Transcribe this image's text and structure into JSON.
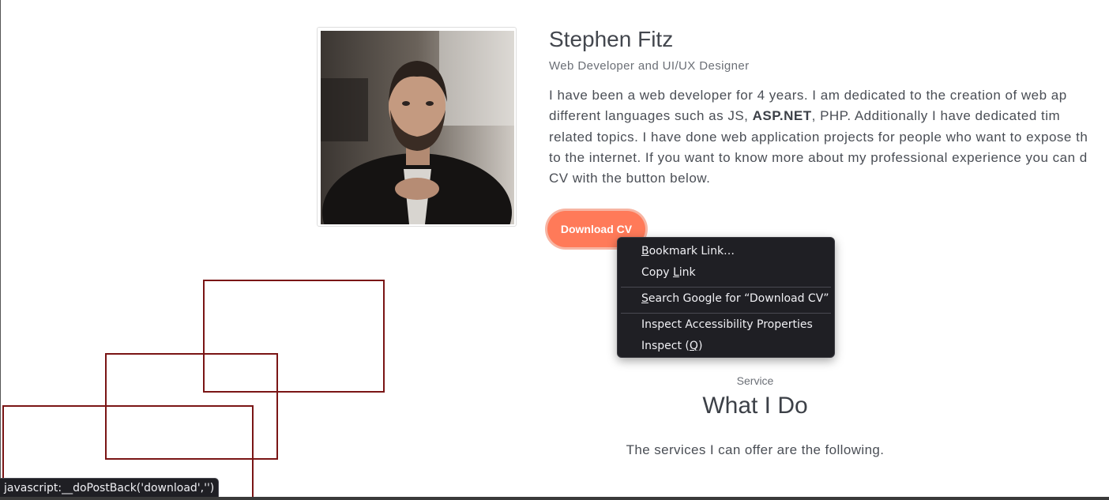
{
  "profile": {
    "name": "Stephen Fitz",
    "subtitle": "Web Developer and UI/UX Designer",
    "bio_lines": [
      [
        "I have been a web developer for 4 years. I am dedicated to the creation of web ap",
        "",
        ""
      ],
      [
        "different languages such as JS, ",
        "ASP.NET",
        ", PHP. Additionally I have dedicated tim"
      ],
      [
        "related topics. I have done web application projects for people who want to expose th",
        "",
        ""
      ],
      [
        "to the internet. If you want to know more about my professional experience you can d",
        "",
        ""
      ],
      [
        "CV with the button below.",
        "",
        ""
      ]
    ],
    "download_label": "Download CV"
  },
  "services": {
    "eyebrow": "Service",
    "title": "What I Do",
    "subtitle": "The services I can offer are the following."
  },
  "context_menu": {
    "items": [
      {
        "prefix": "",
        "accel": "B",
        "rest": "ookmark Link…"
      },
      {
        "prefix": "Copy ",
        "accel": "L",
        "rest": "ink"
      },
      {
        "prefix": "",
        "accel": "S",
        "rest": "earch Google for “Download CV”"
      },
      {
        "prefix": "Inspect Accessibility Properties",
        "accel": "",
        "rest": ""
      },
      {
        "prefix": "Inspect (",
        "accel": "Q",
        "rest": ")"
      }
    ]
  },
  "status_bar": {
    "url": "javascript:__doPostBack('download','')"
  },
  "colors": {
    "accent": "#ff7a59",
    "deco_outline": "#7a1515",
    "menu_bg": "#1f1f24"
  }
}
